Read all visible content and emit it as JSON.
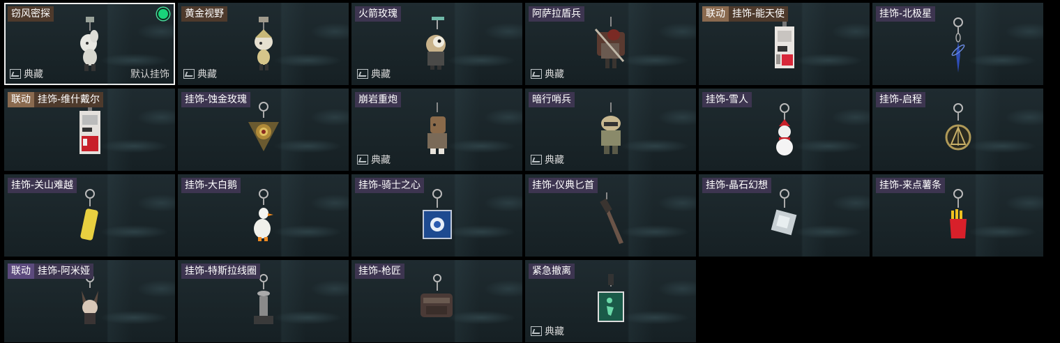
{
  "cards": [
    {
      "name": "窃风密探",
      "tag": "",
      "collect": "典藏",
      "default": "默认挂饰",
      "selected": true,
      "icon": "spy-figure-charm-icon"
    },
    {
      "name": "黄金视野",
      "tag": "",
      "collect": "典藏",
      "icon": "golden-figure-charm-icon"
    },
    {
      "name": "火箭玫瑰",
      "tag": "",
      "collect": "典藏",
      "icon": "rocket-rose-charm-icon"
    },
    {
      "name": "阿萨拉盾兵",
      "tag": "",
      "collect": "典藏",
      "icon": "shield-soldier-charm-icon"
    },
    {
      "name": "挂饰-能天使",
      "tag": "联动",
      "collect": "",
      "icon": "exusiai-card-charm-icon"
    },
    {
      "name": "挂饰-北极星",
      "tag": "",
      "collect": "",
      "icon": "polaris-charm-icon"
    },
    {
      "name": "挂饰-维什戴尔",
      "tag": "联动",
      "collect": "",
      "icon": "wisadel-card-charm-icon"
    },
    {
      "name": "挂饰-蚀金玫瑰",
      "tag": "",
      "collect": "",
      "icon": "gold-rose-charm-icon"
    },
    {
      "name": "崩岩重炮",
      "tag": "",
      "collect": "典藏",
      "icon": "heavy-cannon-charm-icon"
    },
    {
      "name": "暗行哨兵",
      "tag": "",
      "collect": "典藏",
      "icon": "sentinel-charm-icon"
    },
    {
      "name": "挂饰-雪人",
      "tag": "",
      "collect": "",
      "icon": "snowman-charm-icon"
    },
    {
      "name": "挂饰-启程",
      "tag": "",
      "collect": "",
      "icon": "compass-medal-charm-icon"
    },
    {
      "name": "挂饰-关山难越",
      "tag": "",
      "collect": "",
      "icon": "yellow-tag-charm-icon"
    },
    {
      "name": "挂饰-大白鹅",
      "tag": "",
      "collect": "",
      "icon": "white-goose-charm-icon"
    },
    {
      "name": "挂饰-骑士之心",
      "tag": "",
      "collect": "",
      "icon": "knight-heart-charm-icon"
    },
    {
      "name": "挂饰-仪典匕首",
      "tag": "",
      "collect": "",
      "icon": "ceremonial-dagger-charm-icon"
    },
    {
      "name": "挂饰-晶石幻想",
      "tag": "",
      "collect": "",
      "icon": "crystal-charm-icon"
    },
    {
      "name": "挂饰-来点薯条",
      "tag": "",
      "collect": "",
      "icon": "fries-charm-icon"
    },
    {
      "name": "挂饰-阿米娅",
      "tag": "联动",
      "collect": "",
      "icon": "amiya-charm-icon"
    },
    {
      "name": "挂饰-特斯拉线圈",
      "tag": "",
      "collect": "",
      "icon": "tesla-coil-charm-icon"
    },
    {
      "name": "挂饰-枪匠",
      "tag": "",
      "collect": "",
      "icon": "gunsmith-case-charm-icon"
    },
    {
      "name": "紧急撤离",
      "tag": "",
      "collect": "典藏",
      "icon": "evac-sign-charm-icon"
    }
  ],
  "colors": {
    "equipped": "#19d37a",
    "link_tag": "#8a6a4f",
    "purple_tag": "#3d3550"
  }
}
